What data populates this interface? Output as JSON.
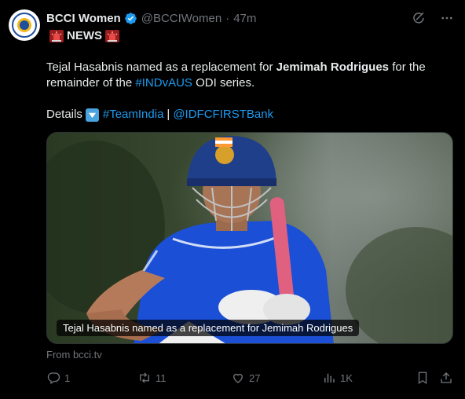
{
  "tweet": {
    "display_name": "BCCI Women",
    "handle": "@BCCIWomen",
    "separator": "·",
    "time": "47m",
    "news_label": "NEWS",
    "text_part1": "Tejal Hasabnis named as a replacement for ",
    "text_bold": "Jemimah Rodrigues",
    "text_part2": " for the remainder of the ",
    "hashtag_series": "#INDvAUS",
    "text_part3": " ODI series.",
    "details_label": "Details",
    "hashtag_team": "#TeamIndia",
    "pipe": "|",
    "mention": "@IDFCFIRSTBank",
    "media_caption": "Tejal Hasabnis named as a replacement for Jemimah Rodrigues",
    "source": "From bcci.tv"
  },
  "actions": {
    "replies": "1",
    "reposts": "11",
    "likes": "27",
    "views": "1K"
  },
  "icons": {
    "verified": "verified-badge-icon",
    "grok": "grok-icon",
    "more": "more-icon",
    "siren": "siren-icon",
    "down": "down-arrow-emoji-icon",
    "reply": "reply-icon",
    "repost": "repost-icon",
    "like": "heart-icon",
    "views": "views-icon",
    "bookmark": "bookmark-icon",
    "share": "share-icon"
  },
  "colors": {
    "background": "#000000",
    "text": "#e7e9ea",
    "muted": "#71767b",
    "link": "#1d9bf0"
  }
}
